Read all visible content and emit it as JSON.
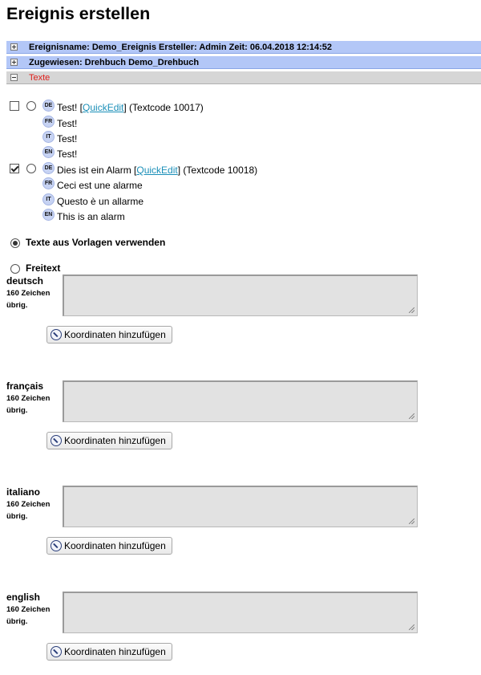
{
  "page": {
    "title": "Ereignis erstellen"
  },
  "sections": {
    "event_info": "Ereignisname: Demo_Ereignis Ersteller: Admin Zeit: 06.04.2018 12:14:52",
    "assigned": "Zugewiesen: Drehbuch Demo_Drehbuch",
    "texts": "Texte"
  },
  "text_entries": [
    {
      "checked": false,
      "translations": [
        {
          "lang": "DE",
          "text": "Test! [",
          "link": "QuickEdit",
          "suffix": "] (Textcode 10017)"
        },
        {
          "lang": "FR",
          "text": "Test!"
        },
        {
          "lang": "IT",
          "text": "Test!"
        },
        {
          "lang": "EN",
          "text": "Test!"
        }
      ]
    },
    {
      "checked": true,
      "translations": [
        {
          "lang": "DE",
          "text": "Dies ist ein Alarm [",
          "link": "QuickEdit",
          "suffix": "] (Textcode 10018)"
        },
        {
          "lang": "FR",
          "text": "Ceci est une alarme"
        },
        {
          "lang": "IT",
          "text": "Questo è un allarme"
        },
        {
          "lang": "EN",
          "text": "This is an alarm"
        }
      ]
    }
  ],
  "options": {
    "use_templates": {
      "label": "Texte aus Vorlagen verwenden",
      "selected": true
    },
    "freetext": {
      "label": "Freitext",
      "selected": false
    }
  },
  "freetext_fields": [
    {
      "language": "deutsch",
      "count_line1": "160 Zeichen",
      "count_line2": "übrig.",
      "button": "Koordinaten hinzufügen"
    },
    {
      "language": "français",
      "count_line1": "160 Zeichen",
      "count_line2": "übrig.",
      "button": "Koordinaten hinzufügen"
    },
    {
      "language": "italiano",
      "count_line1": "160 Zeichen",
      "count_line2": "übrig.",
      "button": "Koordinaten hinzufügen"
    },
    {
      "language": "english",
      "count_line1": "160 Zeichen",
      "count_line2": "übrig.",
      "button": "Koordinaten hinzufügen"
    }
  ]
}
